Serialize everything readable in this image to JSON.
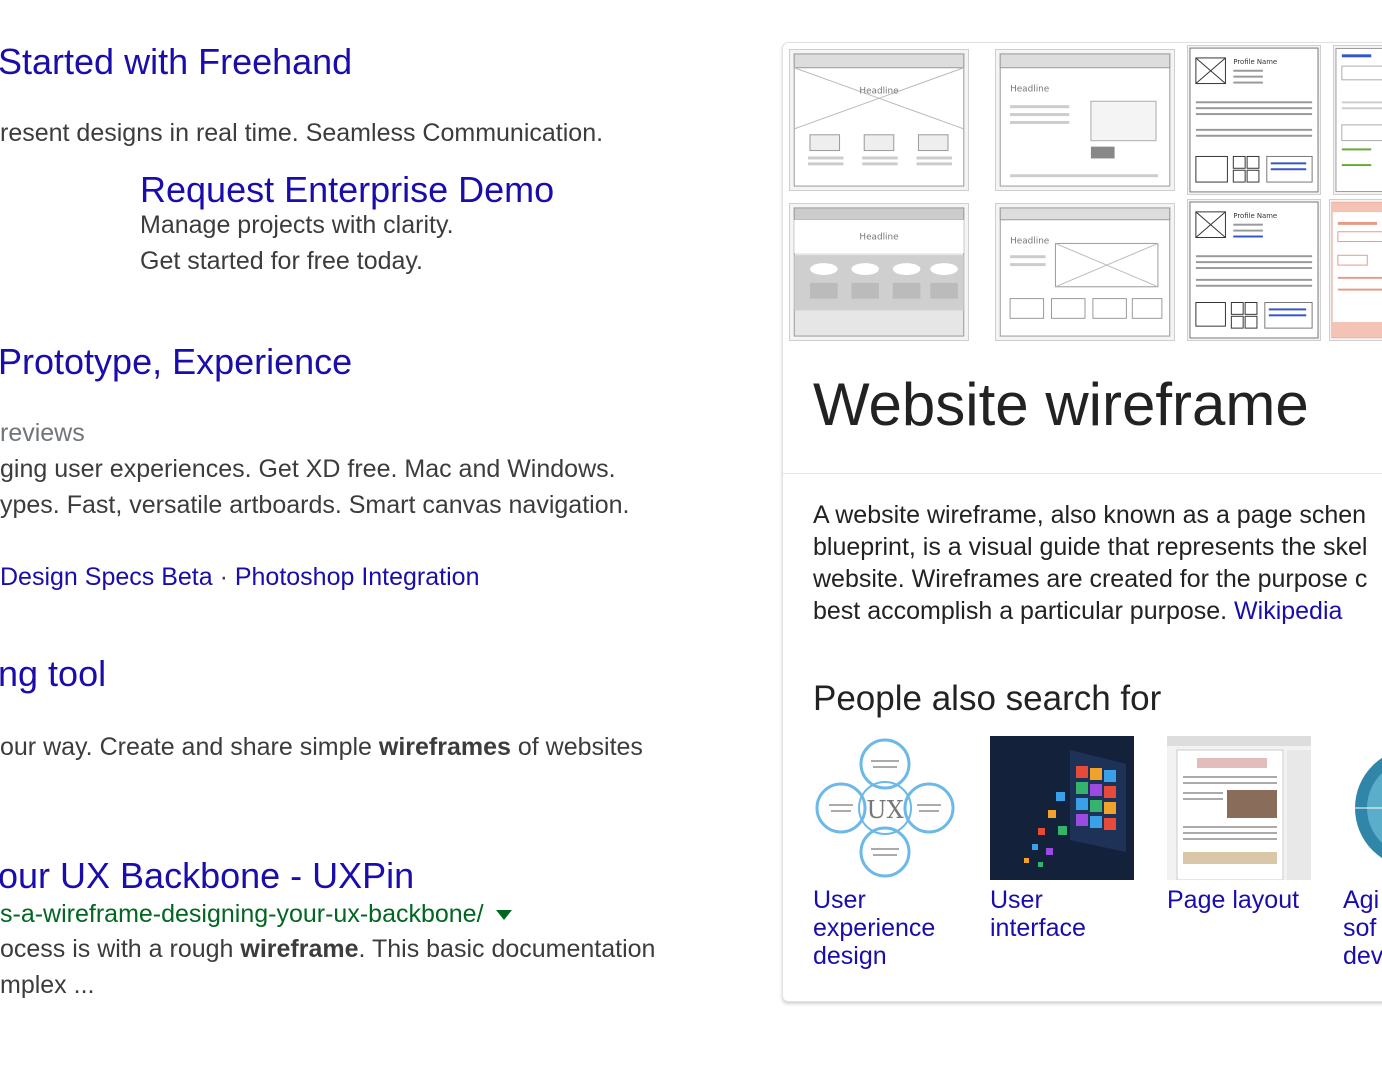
{
  "results": {
    "r1": {
      "title": "Started with Freehand",
      "snippet": "resent designs in real time. Seamless Communication.",
      "sitelink": {
        "title": "Request Enterprise Demo",
        "line1": "Manage projects with clarity.",
        "line2": "Get started for free today."
      }
    },
    "r2": {
      "title": "Prototype, Experience",
      "meta": "reviews",
      "snippet1": "ging user experiences. Get XD free. Mac and Windows.",
      "snippet2": "ypes. Fast, versatile artboards. Smart canvas navigation.",
      "link1": "Design Specs Beta",
      "sep": " · ",
      "link2": "Photoshop Integration"
    },
    "r3": {
      "title": "ng tool",
      "snippet_pre": "our way. Create and share simple ",
      "snippet_bold": "wireframes",
      "snippet_post": " of websites"
    },
    "r4": {
      "title": "our UX Backbone - UXPin",
      "url": "s-a-wireframe-designing-your-ux-backbone/",
      "snippet1_pre": "ocess is with a rough ",
      "snippet1_bold": "wireframe",
      "snippet1_post": ". This basic documentation",
      "snippet2": "mplex ..."
    }
  },
  "knowledge_panel": {
    "title": "Website wireframe",
    "description": "A website wireframe, also known as a page schematic or screen blueprint, is a visual guide that represents the skeletal framework of a website. Wireframes are created for the purpose of arranging elements to best accomplish a particular purpose.",
    "desc_lines": [
      "A website wireframe, also known as a page schen",
      "blueprint, is a visual guide that represents the skel",
      "website. Wireframes are created for the purpose c",
      "best accomplish a particular purpose. "
    ],
    "source_link": "Wikipedia",
    "thumbnails": [
      {
        "thumb_heading": "Headline"
      },
      {
        "thumb_heading": "Headline"
      },
      {
        "thumb_heading": "Profile Name"
      },
      {
        "thumb_heading": ""
      },
      {
        "thumb_heading": "Headline"
      },
      {
        "thumb_heading": "Headline"
      },
      {
        "thumb_heading": "Profile Name"
      },
      {
        "thumb_heading": ""
      }
    ],
    "people_also_search": {
      "heading": "People also search for",
      "items": [
        {
          "label": "User experience design",
          "icon": "ux-diagram-image"
        },
        {
          "label": "User interface",
          "icon": "ui-tiles-image"
        },
        {
          "label": "Page layout",
          "icon": "newspaper-image"
        },
        {
          "label": "Agile software development",
          "label_visible": "Agi sof dev",
          "icon": "agile-circle-image"
        }
      ],
      "ux_center_text": "UX"
    }
  },
  "colors": {
    "link": "#1a0dab",
    "url_green": "#006621",
    "snippet": "#3c3c3c",
    "panel_border": "#dfe1e5"
  }
}
